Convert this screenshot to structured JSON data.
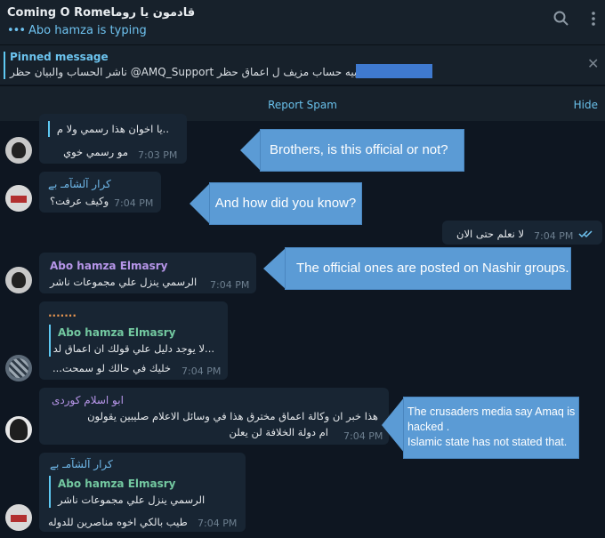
{
  "header": {
    "title": "Coming O Romeقادمون يا روما",
    "typing": "Abo hamza is typing"
  },
  "pinned": {
    "title": "Pinned message",
    "text": "ناشر الحساب والبيان حظر @AMQ_Support تنبيه حساب مزيف ل اعماق حظر"
  },
  "spam_bar": {
    "report": "Report Spam",
    "hide": "Hide"
  },
  "messages": [
    {
      "reply_text": "..يا اخوان هذا رسمي ولا م",
      "text": "مو رسمي خوي",
      "time": "7:03 PM"
    },
    {
      "sender": "كرار آلشآمـ بے",
      "text": "وكيف عرفت؟",
      "time": "7:04 PM"
    },
    {
      "text": "لا نعلم حتى الان",
      "time": "7:04 PM"
    },
    {
      "sender": "Abo hamza Elmasry",
      "text": "الرسمي ينزل علي مجموعات ناشر",
      "time": "7:04 PM"
    },
    {
      "sender": ".......",
      "reply_name": "Abo hamza Elmasry",
      "reply_text": "...لا يوجد دليل علي قولك ان اعماق لد",
      "text": "خليك في حالك لو سمحت...",
      "time": "7:04 PM"
    },
    {
      "sender": "ابو اسلام كوردى",
      "line1": "هذا خبر ان وكالة اعماق  مخترق  هذا في  وسائل  الاعلام  صليبين  يقولون",
      "line2": "ام دولة الخلافة  لن يعلن",
      "time": "7:04 PM"
    },
    {
      "sender": "كرار آلشآمـ بے",
      "reply_name": "Abo hamza Elmasry",
      "reply_text": "الرسمي ينزل علي مجموعات ناشر",
      "text": "طيب بالكي اخوه مناصرين للدوله",
      "time": "7:04 PM"
    }
  ],
  "callouts": {
    "c1": "Brothers, is this official or not?",
    "c2": "And how did you know?",
    "c3": "The official ones are posted on Nashir groups.",
    "c4_line1": "The crusaders media say Amaq is",
    "c4_line2": "hacked .",
    "c4_line3": "Islamic state has not stated that."
  },
  "colors": {
    "background": "#0e1621",
    "header": "#17212b",
    "accent": "#6ec2ef",
    "incoming_bubble": "#182533",
    "outgoing_bubble": "#2b5278",
    "callout": "#5b9bd5"
  }
}
